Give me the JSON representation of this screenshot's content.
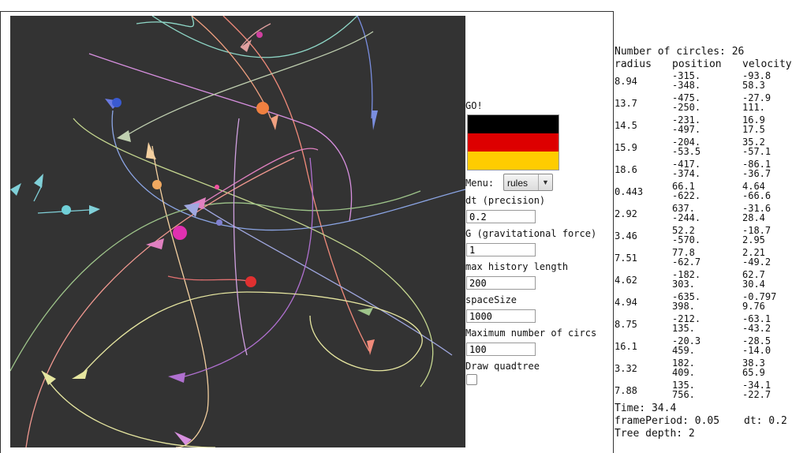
{
  "canvas": {
    "background": "#333333"
  },
  "controls": {
    "go_label": "GO!",
    "flag_colors": [
      "#000000",
      "#dd0000",
      "#ffcc00"
    ],
    "menu_label": "Menu:",
    "menu_value": "rules",
    "dt_label": "dt (precision)",
    "dt_value": "0.2",
    "g_label": "G (gravitational force)",
    "g_value": "1",
    "history_label": "max history length",
    "history_value": "200",
    "space_label": "spaceSize",
    "space_value": "1000",
    "max_circles_label": "Maximum number of circs",
    "max_circles_value": "100",
    "quadtree_label": "Draw quadtree"
  },
  "info": {
    "count_label": "Number of circles: 26",
    "headers": {
      "radius": "radius",
      "position": "position",
      "velocity": "velocity"
    },
    "rows": [
      {
        "r": "8.94",
        "p": "-315.\n-348.",
        "v": "-93.8\n58.3"
      },
      {
        "r": "13.7",
        "p": "-475.\n-250.",
        "v": "-27.9\n111."
      },
      {
        "r": "14.5",
        "p": "-231.\n-497.",
        "v": "16.9\n17.5"
      },
      {
        "r": "15.9",
        "p": "-204.\n-53.5",
        "v": "35.2\n-57.1"
      },
      {
        "r": "18.6",
        "p": "-417.\n-374.",
        "v": "-86.1\n-36.7"
      },
      {
        "r": "0.443",
        "p": "66.1\n-622.",
        "v": "4.64\n-66.6"
      },
      {
        "r": "2.92",
        "p": "637.\n-244.",
        "v": "-31.6\n28.4"
      },
      {
        "r": "3.46",
        "p": "52.2\n-570.",
        "v": "-18.7\n2.95"
      },
      {
        "r": "7.51",
        "p": "77.8\n-62.7",
        "v": "2.21\n-49.2"
      },
      {
        "r": "4.62",
        "p": "-182.\n303.",
        "v": "62.7\n30.4"
      },
      {
        "r": "4.94",
        "p": "-635.\n398.",
        "v": "-0.797\n9.76"
      },
      {
        "r": "8.75",
        "p": "-212.\n135.",
        "v": "-63.1\n-43.2"
      },
      {
        "r": "16.1",
        "p": "-20.3\n459.",
        "v": "-28.5\n-14.0"
      },
      {
        "r": "3.32",
        "p": "182.\n409.",
        "v": "38.3\n65.9"
      },
      {
        "r": "7.88",
        "p": "135.\n756.",
        "v": "-34.1\n-22.7"
      }
    ],
    "time_label": "Time: 34.4",
    "frame_label": "framePeriod: 0.05",
    "dt_label": "dt: 0.2",
    "tree_label": "Tree depth: 2"
  }
}
